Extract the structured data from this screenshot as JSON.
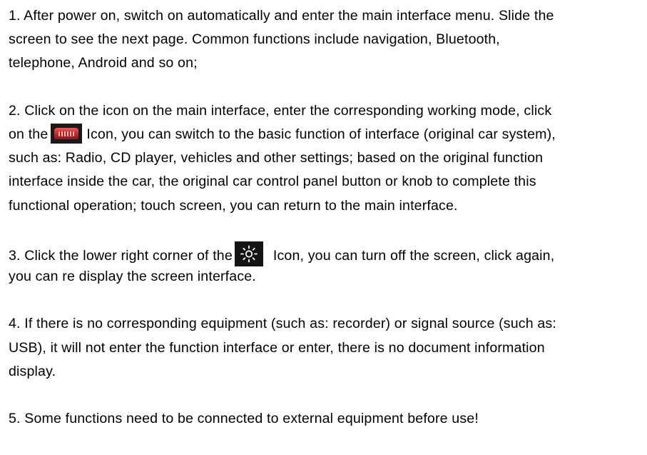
{
  "paragraphs": [
    {
      "lines": [
        "1. After power on, switch on automatically and enter the main interface menu. Slide the",
        "screen to see the next page. Common functions include navigation, Bluetooth,",
        "telephone, Android and so on;"
      ]
    },
    {
      "line1": "2. Click on the icon on the main interface, enter the corresponding working mode, click",
      "line2_before": "on the",
      "line2_after": "Icon, you can switch to the basic function of interface (original car system),",
      "lines_rest": [
        "such as: Radio, CD player, vehicles and other settings; based on the original function",
        "interface inside the car, the original car control panel button or knob to complete this",
        "functional operation; touch screen, you can return to the main interface."
      ],
      "icon": "car-function-icon"
    },
    {
      "line1_before": "3. Click the lower right corner of the",
      "line1_after": "Icon, you can turn off the screen, click again,",
      "line2": "you can re display the screen interface.",
      "icon": "brightness-sun-icon"
    },
    {
      "lines": [
        "4. If there is no corresponding equipment (such as: recorder) or signal source (such as:",
        "USB), it will not enter the function interface or enter, there is no document information",
        "display."
      ]
    },
    {
      "lines": [
        "5. Some functions need to be connected to external equipment before use!"
      ]
    }
  ],
  "colors": {
    "text": "#000000",
    "background": "#ffffff",
    "icon_bg": "#141414",
    "car_icon_red": "#c62828"
  }
}
